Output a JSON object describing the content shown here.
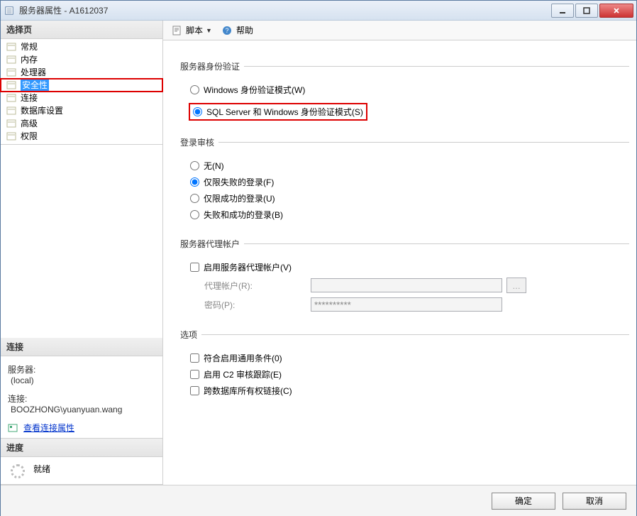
{
  "titlebar": {
    "title": "服务器属性 - A1612037"
  },
  "sidebar": {
    "select_page_header": "选择页",
    "items": [
      {
        "label": "常规"
      },
      {
        "label": "内存"
      },
      {
        "label": "处理器"
      },
      {
        "label": "安全性"
      },
      {
        "label": "连接"
      },
      {
        "label": "数据库设置"
      },
      {
        "label": "高级"
      },
      {
        "label": "权限"
      }
    ],
    "connection_header": "连接",
    "server_label": "服务器:",
    "server_value": "(local)",
    "conn_label": "连接:",
    "conn_value": "BOOZHONG\\yuanyuan.wang",
    "view_conn_props": "查看连接属性",
    "progress_header": "进度",
    "progress_status": "就绪"
  },
  "toolbar": {
    "script_label": "脚本",
    "help_label": "帮助"
  },
  "main": {
    "auth_group": "服务器身份验证",
    "auth_windows": "Windows 身份验证模式(W)",
    "auth_mixed": "SQL Server 和 Windows 身份验证模式(S)",
    "audit_group": "登录审核",
    "audit_none": "无(N)",
    "audit_failed": "仅限失败的登录(F)",
    "audit_success": "仅限成功的登录(U)",
    "audit_both": "失败和成功的登录(B)",
    "proxy_group": "服务器代理帐户",
    "proxy_enable": "启用服务器代理帐户(V)",
    "proxy_account_label": "代理帐户(R):",
    "proxy_password_label": "密码(P):",
    "proxy_password_value": "**********",
    "options_group": "选项",
    "opt_common_criteria": "符合启用通用条件(0)",
    "opt_c2": "启用 C2 审核跟踪(E)",
    "opt_cross_db": "跨数据库所有权链接(C)"
  },
  "footer": {
    "ok": "确定",
    "cancel": "取消"
  }
}
